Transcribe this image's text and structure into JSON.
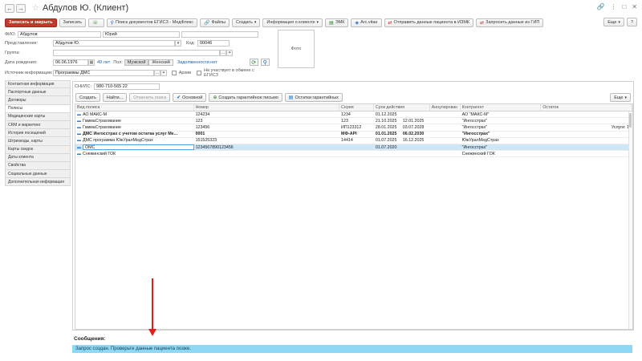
{
  "window": {
    "title": "Абдулов Ю. (Клиент)",
    "back": "←",
    "forward": "→",
    "star": "☆",
    "controls": [
      "🔗",
      "⋮",
      "□",
      "✕"
    ]
  },
  "toolbar": {
    "save_close": "Записать и закрыть",
    "save": "Записать",
    "search_egisz": "Поиск документов ЕГИСЗ - МедФлекс",
    "files": "Файлы",
    "create": "Создать",
    "client_info": "Информация о клиенте",
    "emk": "ЭМК",
    "arc_vitae": "Arc.vitae",
    "send_izmk": "Отправить данные пациента в ИЗМК",
    "request_gip": "Запросить данные из ГИП",
    "more": "Еще",
    "help": "?"
  },
  "form": {
    "fio_label": "ФИО:",
    "last_name": "Абдулов",
    "first_name": "Юрий",
    "middle_name": "",
    "representation_label": "Представление:",
    "representation": "Абдулов Ю.",
    "code_label": "Код:",
    "code": "00046",
    "group_label": "Группа:",
    "group": "",
    "birth_label": "Дата рождения:",
    "birth_date": "06.06.1976",
    "age": "49 лет",
    "sex_label": "Пол:",
    "sex_male": "Мужской",
    "sex_female": "Женский",
    "debt": "Задолженности нет",
    "source_label": "Источник информации:",
    "source": "Программы ДМС",
    "archive_label": "Архив",
    "egisz_label": "Не участвует в обмене с ЕГИСЗ",
    "photo": "Фото"
  },
  "sidebar": {
    "items": [
      "Контактная информация",
      "Паспортные данные",
      "Договоры",
      "Полисы",
      "Медицинские карты",
      "CRM и маркетинг",
      "История посещений",
      "Штрихкоды, карты",
      "Карты скидок",
      "Даты клиента",
      "Свойства",
      "Социальные данные",
      "Дополнительная информация"
    ]
  },
  "policies": {
    "snils_label": "СНИЛС:",
    "snils": "980-710-565 22",
    "buttons": {
      "create": "Создать",
      "find": "Найти...",
      "cancel_search": "Отменить поиск",
      "main": "Основной",
      "create_guarantee": "Создать гарантийное письмо",
      "guarantee_balances": "Остатки гарантийных"
    },
    "more": "Еще",
    "columns": [
      "Вид полиса",
      "Номер",
      "Серия",
      "Срок действия",
      "Аннулирован",
      "Контрагент",
      "Остаток"
    ],
    "rows": [
      {
        "kind": "АО МАКС-М",
        "number": "124234",
        "series": "1234",
        "from": "01.12.2025",
        "to": "",
        "annulled": "",
        "counterparty": "АО \"МАКС-М\"",
        "rest": ""
      },
      {
        "kind": "ГаммаСтрахование",
        "number": "123",
        "series": "123",
        "from": "21.10.2025",
        "to": "12.01.2025",
        "annulled": "",
        "counterparty": "\"Ингосстрах\"",
        "rest": ""
      },
      {
        "kind": "ГаммаСтрахование",
        "number": "123456",
        "series": "ИП123312",
        "from": "28.01.2025",
        "to": "03.07.2028",
        "annulled": "",
        "counterparty": "\"Ингосстрах\"",
        "rest": "Услуги: 1"
      },
      {
        "kind": "ДМС Ингосстрах с учетом остатка услуг Ме...",
        "number": "0001",
        "series": "МФ-API",
        "from": "01.01.2025",
        "to": "06.02.2030",
        "annulled": "",
        "counterparty": "\"Ингосстрах\"",
        "rest": ""
      },
      {
        "kind": "ДМС программа ЮжУралМедСтрах",
        "number": "151525323",
        "series": "14414",
        "from": "01.07.2025",
        "to": "16.12.2025",
        "annulled": "",
        "counterparty": "ЮжУралМедСтрах",
        "rest": ""
      },
      {
        "kind": "ОМС",
        "number": "1234567890123456",
        "series": "",
        "from": "01.07.2020",
        "to": "",
        "annulled": "",
        "counterparty": "\"Ингосстрах\"",
        "rest": ""
      },
      {
        "kind": "Снежинский ГОК",
        "number": "",
        "series": "",
        "from": "",
        "to": "",
        "annulled": "",
        "counterparty": "Снежинский ГОК",
        "rest": ""
      }
    ]
  },
  "messages": {
    "title": "Сообщения:",
    "text": "Запрос создан. Проверьте данные пациента позже."
  }
}
